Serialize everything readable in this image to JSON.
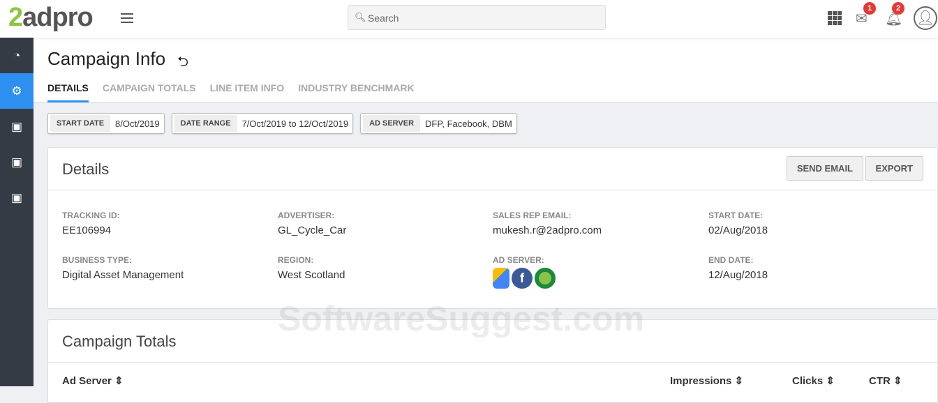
{
  "logo": {
    "first": "2",
    "rest": "adpro"
  },
  "search": {
    "placeholder": "Search"
  },
  "header": {
    "mail_count": "1",
    "notif_count": "2"
  },
  "page": {
    "title": "Campaign Info"
  },
  "tabs": [
    "DETAILS",
    "CAMPAIGN TOTALS",
    "LINE ITEM INFO",
    "INDUSTRY BENCHMARK"
  ],
  "chips": [
    {
      "label": "START DATE",
      "value": "8/Oct/2019"
    },
    {
      "label": "DATE RANGE",
      "value": "7/Oct/2019 to 12/Oct/2019"
    },
    {
      "label": "AD SERVER",
      "value": "DFP, Facebook, DBM"
    }
  ],
  "details": {
    "title": "Details",
    "send_email": "SEND EMAIL",
    "export": "EXPORT",
    "fields": [
      {
        "label": "TRACKING ID:",
        "value": "EE106994"
      },
      {
        "label": "ADVERTISER:",
        "value": "GL_Cycle_Car"
      },
      {
        "label": "SALES REP EMAIL:",
        "value": "mukesh.r@2adpro.com"
      },
      {
        "label": "START DATE:",
        "value": "02/Aug/2018"
      },
      {
        "label": "BUSINESS TYPE:",
        "value": "Digital Asset Management"
      },
      {
        "label": "REGION:",
        "value": "West Scotland"
      },
      {
        "label": "AD SERVER:",
        "value": ""
      },
      {
        "label": "END DATE:",
        "value": "12/Aug/2018"
      }
    ]
  },
  "totals": {
    "title": "Campaign Totals",
    "columns": [
      "Ad Server",
      "Impressions",
      "Clicks",
      "CTR"
    ]
  },
  "watermark": "SoftwareSuggest.com"
}
